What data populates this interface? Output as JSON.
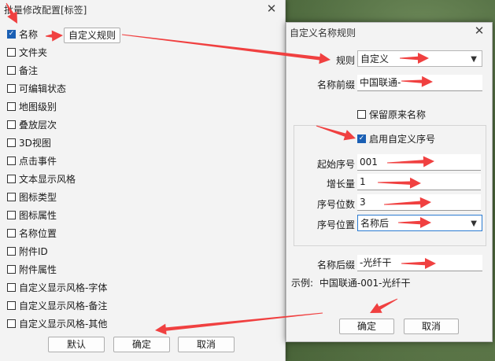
{
  "batch_dialog": {
    "title": "批量修改配置[标签]",
    "close_glyph": "✕",
    "items": [
      {
        "label": "名称",
        "checked": true
      },
      {
        "label": "文件夹",
        "checked": false
      },
      {
        "label": "备注",
        "checked": false
      },
      {
        "label": "可编辑状态",
        "checked": false
      },
      {
        "label": "地图级别",
        "checked": false
      },
      {
        "label": "叠放层次",
        "checked": false
      },
      {
        "label": "3D视图",
        "checked": false
      },
      {
        "label": "点击事件",
        "checked": false
      },
      {
        "label": "文本显示风格",
        "checked": false
      },
      {
        "label": "图标类型",
        "checked": false
      },
      {
        "label": "图标属性",
        "checked": false
      },
      {
        "label": "名称位置",
        "checked": false
      },
      {
        "label": "附件ID",
        "checked": false
      },
      {
        "label": "附件属性",
        "checked": false
      },
      {
        "label": "自定义显示风格-字体",
        "checked": false
      },
      {
        "label": "自定义显示风格-备注",
        "checked": false
      },
      {
        "label": "自定义显示风格-其他",
        "checked": false
      }
    ],
    "custom_rule_button": "自定义规则",
    "default_button": "默认",
    "ok_button": "确定",
    "cancel_button": "取消"
  },
  "rule_dialog": {
    "title": "自定义名称规则",
    "close_glyph": "✕",
    "rule_label": "规则",
    "rule_value": "自定义",
    "prefix_label": "名称前缀",
    "prefix_value": "中国联通-",
    "keep_original_label": "保留原来名称",
    "keep_original_checked": false,
    "enable_seq_label": "启用自定义序号",
    "enable_seq_checked": true,
    "start_label": "起始序号",
    "start_value": "001",
    "step_label": "增长量",
    "step_value": "1",
    "digits_label": "序号位数",
    "digits_value": "3",
    "position_label": "序号位置",
    "position_value": "名称后",
    "suffix_label": "名称后缀",
    "suffix_value": "-光纤干",
    "example_label": "示例:",
    "example_value": "中国联通-001-光纤干",
    "ok_button": "确定",
    "cancel_button": "取消"
  },
  "colors": {
    "arrow": "#f04040",
    "checkbox_checked": "#1a5fb4",
    "focus_border": "#2b7bd1"
  },
  "icons": {
    "dropdown": "chevron-down-icon",
    "close": "close-icon",
    "check": "check-icon"
  }
}
